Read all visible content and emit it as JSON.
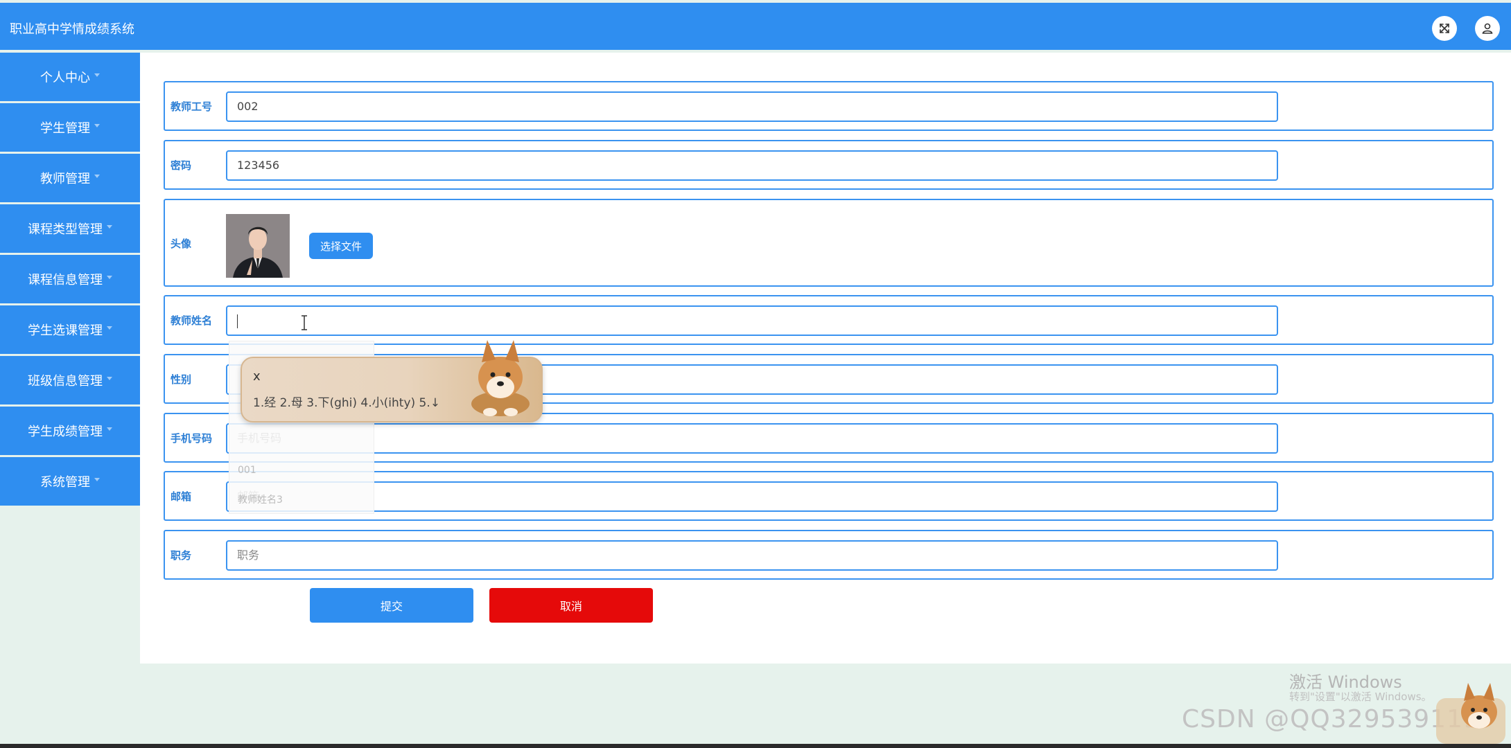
{
  "header": {
    "title": "职业高中学情成绩系统",
    "fullscreen_icon": "fullscreen-icon",
    "user_icon": "user-icon"
  },
  "sidebar": {
    "items": [
      {
        "label": "个人中心"
      },
      {
        "label": "学生管理"
      },
      {
        "label": "教师管理"
      },
      {
        "label": "课程类型管理"
      },
      {
        "label": "课程信息管理"
      },
      {
        "label": "学生选课管理"
      },
      {
        "label": "班级信息管理"
      },
      {
        "label": "学生成绩管理"
      },
      {
        "label": "系统管理"
      }
    ]
  },
  "form": {
    "teacher_id": {
      "label": "教师工号",
      "value": "002"
    },
    "password": {
      "label": "密码",
      "value": "123456"
    },
    "avatar": {
      "label": "头像",
      "button": "选择文件"
    },
    "teacher_name": {
      "label": "教师姓名",
      "value": ""
    },
    "gender": {
      "label": "性别",
      "value": ""
    },
    "phone": {
      "label": "手机号码",
      "placeholder": "手机号码"
    },
    "email": {
      "label": "邮箱",
      "placeholder": "邮箱"
    },
    "position": {
      "label": "职务",
      "placeholder": "职务"
    },
    "submit": "提交",
    "cancel": "取消"
  },
  "autocomplete": {
    "items": [
      "001",
      "教师姓名3"
    ]
  },
  "ime": {
    "input": "x",
    "candidates": "1.经  2.母  3.下(ghi)  4.小(ihty)  5.↓"
  },
  "watermark": {
    "activate": "激活 Windows",
    "activate_hint": "转到\"设置\"以激活 Windows。",
    "csdn": "CSDN @QQ3295391197"
  }
}
